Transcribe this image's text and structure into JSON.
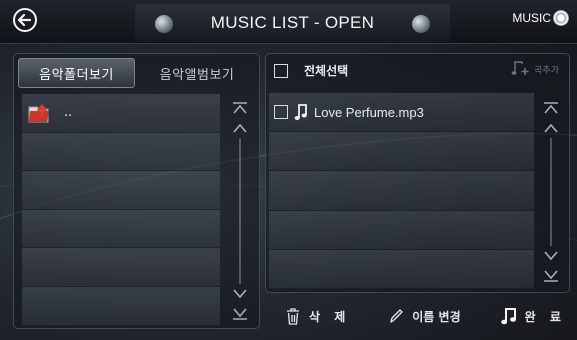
{
  "header": {
    "title": "MUSIC LIST - OPEN",
    "logo_text": "MUSIC",
    "back_icon": "circle-arrow-left-icon"
  },
  "left_panel": {
    "tabs": [
      {
        "label": "음악폴더보기",
        "active": true
      },
      {
        "label": "음악앨범보기",
        "active": false
      }
    ],
    "items": [
      {
        "icon": "folder-up-icon",
        "label": ".."
      }
    ],
    "row_count": 6
  },
  "right_panel": {
    "select_all_label": "전체선택",
    "select_all_checked": false,
    "add_track_label": "곡추가",
    "add_track_enabled": false,
    "files": [
      {
        "name": "Love Perfume.mp3",
        "checked": false,
        "icon": "music-note-icon"
      }
    ],
    "row_count": 5
  },
  "actions": {
    "delete_label": "삭 제",
    "rename_label": "이름 변경",
    "done_label": "완 료"
  },
  "colors": {
    "background": "#232830",
    "panel_border": "#424852",
    "text": "#e8eaee",
    "disabled": "#6e747d"
  }
}
